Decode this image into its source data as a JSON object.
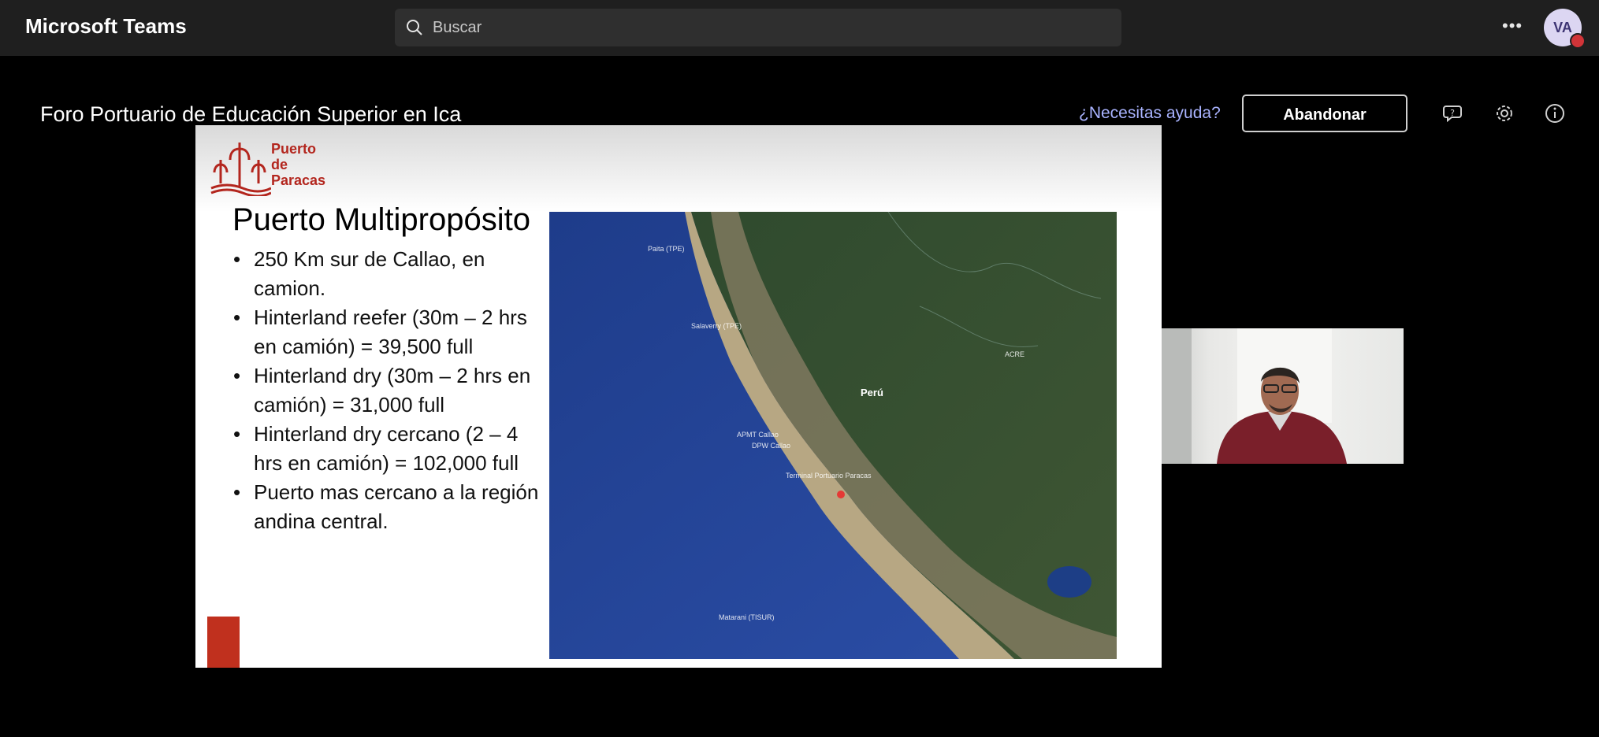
{
  "app": {
    "title": "Microsoft Teams"
  },
  "search": {
    "placeholder": "Buscar"
  },
  "user": {
    "initials": "VA",
    "status_color": "#d13438"
  },
  "meeting": {
    "title": "Foro Portuario de Educación Superior en Ica",
    "help_link": "¿Necesitas ayuda?",
    "leave_label": "Abandonar"
  },
  "icons": [
    "search-icon",
    "more-options-icon",
    "chat-help-icon",
    "settings-icon",
    "info-icon"
  ],
  "slide": {
    "logo_lines": [
      "Puerto",
      "de",
      "Paracas"
    ],
    "title": "Puerto Multipropósito",
    "bullets": [
      "250 Km sur de Callao, en camion.",
      "Hinterland reefer (30m – 2 hrs en camión) = 39,500 full",
      "Hinterland dry (30m – 2 hrs en camión) = 31,000 full",
      "Hinterland dry cercano (2 – 4 hrs en camión) = 102,000 full",
      "Puerto mas cercano a la región andina central."
    ],
    "map_labels": {
      "peru": "Perú",
      "acre": "ACRE",
      "paita": "Paita (TPE)",
      "salaverry": "Salaverry (TPE)",
      "apmt": "APMT Callao",
      "dpw": "DPW Callao",
      "terminal": "Terminal Portuario Paracas",
      "matarani": "Matarani (TISUR)"
    },
    "accent_color": "#b3261e"
  }
}
